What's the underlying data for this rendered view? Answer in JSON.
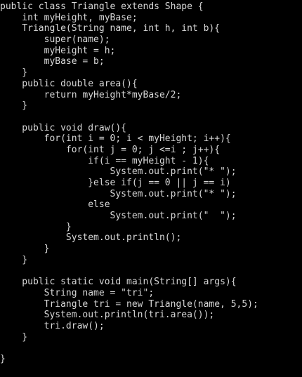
{
  "editor": {
    "background": "#000000",
    "text_color": "#d8d8d8",
    "lines": [
      "public class Triangle extends Shape {",
      "    int myHeight, myBase;",
      "    Triangle(String name, int h, int b){",
      "        super(name);",
      "        myHeight = h;",
      "        myBase = b;",
      "    }",
      "    public double area(){",
      "        return myHeight*myBase/2;",
      "    }",
      "",
      "    public void draw(){",
      "        for(int i = 0; i < myHeight; i++){",
      "            for(int j = 0; j <=i ; j++){",
      "                if(i == myHeight - 1){",
      "                    System.out.print(\"* \");",
      "                }else if(j == 0 || j == i)",
      "                    System.out.print(\"* \");",
      "                else",
      "                    System.out.print(\"  \");",
      "            }",
      "            System.out.println();",
      "        }",
      "    }",
      "",
      "    public static void main(String[] args){",
      "        String name = \"tri\";",
      "        Triangle tri = new Triangle(name, 5,5);",
      "        System.out.println(tri.area());",
      "        tri.draw();",
      "    }",
      "",
      "}"
    ]
  }
}
